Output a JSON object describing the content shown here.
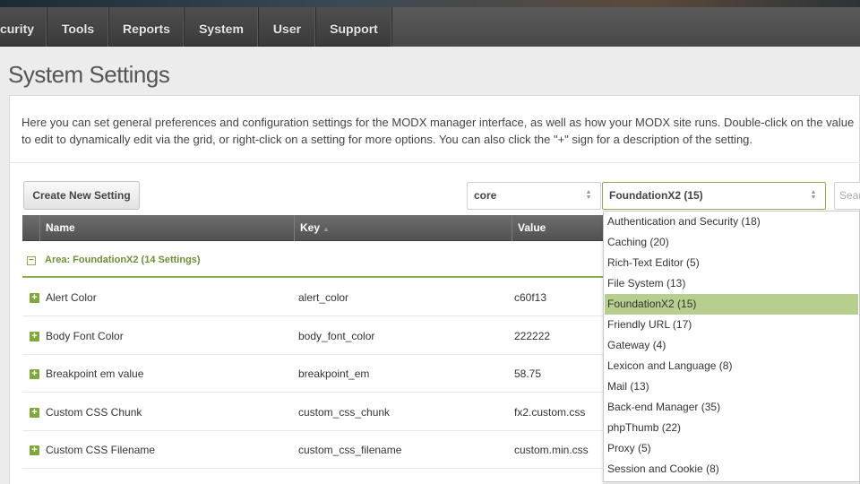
{
  "nav": {
    "items": [
      {
        "label": "curity"
      },
      {
        "label": "Tools"
      },
      {
        "label": "Reports"
      },
      {
        "label": "System"
      },
      {
        "label": "User"
      },
      {
        "label": "Support"
      }
    ]
  },
  "page": {
    "title": "System Settings",
    "description_line1": "Here you can set general preferences and configuration settings for the MODX manager interface, as well as how your MODX site runs. Double-click on the value",
    "description_line2": "to edit to dynamically edit via the grid, or right-click on a setting for more options. You can also click the \"+\" sign for a description of the setting."
  },
  "toolbar": {
    "create_label": "Create New Setting",
    "namespace_value": "core",
    "area_value": "FoundationX2 (15)",
    "search_placeholder": "Sear"
  },
  "grid": {
    "columns": {
      "name": "Name",
      "key": "Key",
      "value": "Value"
    },
    "group_label": "Area: FoundationX2 (14 Settings)",
    "rows": [
      {
        "name": "Alert Color",
        "key": "alert_color",
        "value": "c60f13"
      },
      {
        "name": "Body Font Color",
        "key": "body_font_color",
        "value": "222222"
      },
      {
        "name": "Breakpoint em value",
        "key": "breakpoint_em",
        "value": "58.75"
      },
      {
        "name": "Custom CSS Chunk",
        "key": "custom_css_chunk",
        "value": "fx2.custom.css"
      },
      {
        "name": "Custom CSS Filename",
        "key": "custom_css_filename",
        "value": "custom.min.css"
      }
    ]
  },
  "area_dropdown": {
    "selected_index": 4,
    "selected_color": "#b7cf8e",
    "options": [
      "Authentication and Security (18)",
      "Caching (20)",
      "Rich-Text Editor (5)",
      "File System (13)",
      "FoundationX2 (15)",
      "Friendly URL (17)",
      "Gateway (4)",
      "Lexicon and Language (8)",
      "Mail (13)",
      "Back-end Manager (35)",
      "phpThumb (22)",
      "Proxy (5)",
      "Session and Cookie (8)"
    ]
  },
  "colors": {
    "accent_green": "#8fae54",
    "group_text": "#6e8f31",
    "nav_bg": "#444444"
  }
}
